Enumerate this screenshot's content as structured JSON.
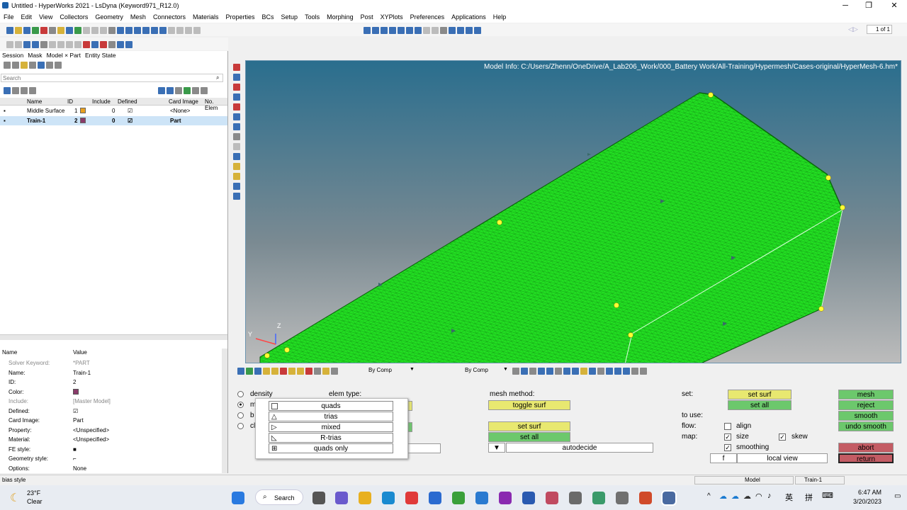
{
  "window": {
    "title": "Untitled - HyperWorks 2021 - LsDyna (Keyword971_R12.0)",
    "min": "─",
    "max": "❐",
    "close": "✕"
  },
  "menu": [
    "File",
    "Edit",
    "View",
    "Collectors",
    "Geometry",
    "Mesh",
    "Connectors",
    "Materials",
    "Properties",
    "BCs",
    "Setup",
    "Tools",
    "Morphing",
    "Post",
    "XYPlots",
    "Preferences",
    "Applications",
    "Help"
  ],
  "page_indicator": "1 of 1",
  "browser": {
    "tabs": [
      "Session",
      "Mask",
      "Model × Part",
      "Entity State"
    ],
    "search_placeholder": "Search",
    "columns": [
      "Name",
      "ID",
      "Include",
      "Defined",
      "Card Image",
      "No. Elem"
    ],
    "rows": [
      {
        "name": "Middle Surface",
        "id": "1",
        "include": "0",
        "card": "<None>",
        "color": "#e8a020"
      },
      {
        "name": "Train-1",
        "id": "2",
        "include": "0",
        "card": "Part",
        "color": "#8a3a6a"
      }
    ]
  },
  "props": {
    "header_name": "Name",
    "header_value": "Value",
    "items": [
      {
        "k": "Solver Keyword:",
        "v": "*PART"
      },
      {
        "k": "Name:",
        "v": "Train-1"
      },
      {
        "k": "ID:",
        "v": "2"
      },
      {
        "k": "Color:",
        "v": ""
      },
      {
        "k": "Include:",
        "v": "[Master Model]"
      },
      {
        "k": "Defined:",
        "v": "☑"
      },
      {
        "k": "Card Image:",
        "v": "Part"
      },
      {
        "k": "Property:",
        "v": "<Unspecified>"
      },
      {
        "k": "Material:",
        "v": "<Unspecified>"
      },
      {
        "k": "FE style:",
        "v": "■"
      },
      {
        "k": "Geometry style:",
        "v": "⌐"
      },
      {
        "k": "Options:",
        "v": "None"
      }
    ]
  },
  "viewport": {
    "model_info": "Model Info: C:/Users/Zhenn/OneDrive/A_Lab206_Work/000_Battery Work/All-Training/Hypermesh/Cases-original/HyperMesh-6.hm*",
    "axis_z": "Z",
    "axis_y": "Y",
    "by_comp_1": "By Comp",
    "by_comp_2": "By Comp"
  },
  "panel": {
    "radios": [
      "density",
      "m",
      "b",
      "cl"
    ],
    "elem_type": "elem type:",
    "mesh_method": "mesh method:",
    "toggle_surf": "toggle surf",
    "set_surf_mid": "set surf",
    "set_all_mid": "set all",
    "autodecide": "autodecide",
    "set_label": "set:",
    "set_surf": "set surf",
    "set_all": "set all",
    "to_use": "to use:",
    "flow": "flow:",
    "align": "align",
    "map": "map:",
    "size": "size",
    "skew": "skew",
    "smoothing": "smoothing",
    "f": "f",
    "local_view": "local view",
    "mesh": "mesh",
    "reject": "reject",
    "smooth": "smooth",
    "undo_smooth": "undo smooth",
    "abort": "abort",
    "return": "return",
    "dropdown": [
      "quads",
      "trias",
      "mixed",
      "R-trias",
      "quads only"
    ]
  },
  "status": {
    "left": "bias style",
    "model": "Model",
    "part": "Train-1"
  },
  "taskbar": {
    "temp": "23°F",
    "weather": "Clear",
    "search": "Search",
    "time": "6:47 AM",
    "date": "3/20/2023",
    "lang": "英",
    "ime": "拼"
  },
  "colors": {
    "mesh": "#22dd22",
    "accent": "#c8e2f7"
  }
}
